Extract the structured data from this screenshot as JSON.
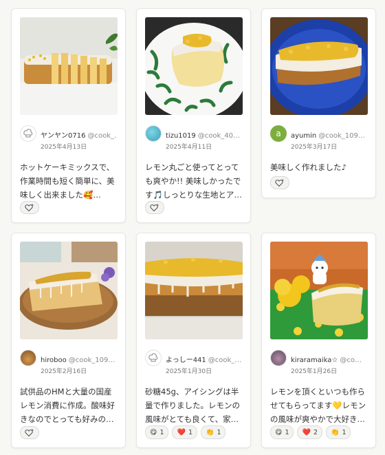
{
  "cards": [
    {
      "username": "ヤンヤン0716",
      "user_id": "@cook_…",
      "date": "2025年4月13日",
      "text": "ホットケーキミックスで、作業時間も短く簡単に、美味しく出来ました🥰…",
      "avatar_icon": "chef-hat-icon"
    },
    {
      "username": "tizu1019",
      "user_id": "@cook_40…",
      "date": "2025年4月11日",
      "text": "レモン丸ごと使ってとっても爽やか!! 美味しかったです🎵しっとりな生地とア…",
      "avatar_icon": "photo-avatar"
    },
    {
      "username": "ayumin",
      "user_id": "@cook_109…",
      "date": "2025年3月17日",
      "text": "美味しく作れました♪",
      "avatar_letter": "a"
    },
    {
      "username": "hiroboo",
      "user_id": "@cook_109…",
      "date": "2025年2月16日",
      "text": "試供品のHMと大量の国産レモン消費に作成。酸味好きなのでとっても好みの…",
      "avatar_icon": "photo-avatar"
    },
    {
      "username": "よっしー441",
      "user_id": "@cook_…",
      "date": "2025年1月30日",
      "text": "砂糖45g、アイシングは半量で作りました。レモンの風味がとても良くて、家…",
      "avatar_icon": "chef-hat-icon",
      "reactions": [
        {
          "emoji": "😋",
          "count": "1"
        },
        {
          "emoji": "❤️",
          "count": "1"
        },
        {
          "emoji": "👏",
          "count": "1"
        }
      ]
    },
    {
      "username": "kiraramaika☆",
      "user_id": "@co…",
      "date": "2025年1月26日",
      "text": "レモンを頂くといつも作らせてもらってます💛レモンの風味が爽やかで大好き…",
      "avatar_icon": "photo-avatar",
      "reactions": [
        {
          "emoji": "😋",
          "count": "1"
        },
        {
          "emoji": "❤️",
          "count": "2"
        },
        {
          "emoji": "👏",
          "count": "1"
        }
      ]
    }
  ],
  "like_button_icon": "heart-plus-icon",
  "colors": {
    "card_border": "#e6e6e2",
    "avatar_a_bg": "#7cae3f",
    "lemon_zest": "#e8b92a",
    "cake_crumb": "#d9a441"
  }
}
